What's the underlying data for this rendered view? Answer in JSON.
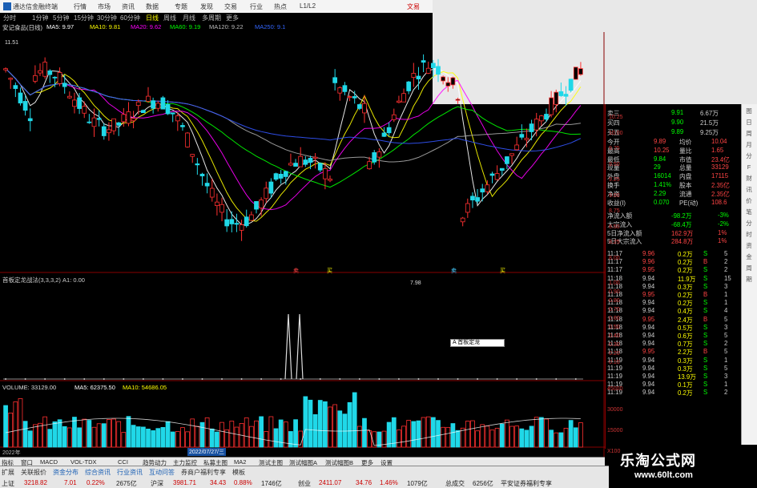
{
  "window": {
    "title": "通达信金融终端",
    "right_label": "文易"
  },
  "menu": [
    "行情",
    "市场",
    "资讯",
    "数据",
    "专题",
    "发现",
    "交易",
    "行业",
    "热点",
    "L1/L2"
  ],
  "periods": [
    "分时",
    "1分钟",
    "5分钟",
    "15分钟",
    "30分钟",
    "60分钟",
    "日线",
    "周线",
    "月线",
    "多周期",
    "更多"
  ],
  "active_period": "日线",
  "chart_info": {
    "name": "安记食品(日线)",
    "ma": [
      "MA5: 9.97",
      "MA10: 9.81",
      "MA20: 9.62",
      "MA60: 9.19",
      "MA120: 9.22",
      "MA250: 9.1"
    ],
    "ma_colors": [
      "#ffffff",
      "#ffff00",
      "#ff00ff",
      "#00ff00",
      "#aaaaaa",
      "#3355ff"
    ],
    "high_label": "11.51",
    "low_label": "7.98"
  },
  "indicator": {
    "label": "首板定龙战法(3,3,3,2) A1: 0.00",
    "tooltip": "A 首板定龙"
  },
  "volume": {
    "label": "VOLUME: 33129.00",
    "ma5": "MA5: 62375.50",
    "ma10": "MA10: 54686.05",
    "date_label": "2022/07/27/三",
    "year_label": "2022年"
  },
  "price_ticks": [
    "10.25",
    "10.00",
    "9.75",
    "9.50",
    "9.25",
    "9.00",
    "8.75",
    "8.50",
    "8.25",
    "8.00"
  ],
  "ind_ticks": [
    "1.00",
    "0.90",
    "0.80",
    "0.70",
    "0.60",
    "0.50",
    "0.40",
    "0.30",
    "0.20",
    "0.10"
  ],
  "vol_ticks": [
    "45000",
    "30000",
    "15000",
    "X100"
  ],
  "markers": {
    "sell_a": "卖",
    "buy_a": "买",
    "sell_b": "卖",
    "buy_b": "买"
  },
  "quote": {
    "ask3": [
      "卖三",
      "9.91",
      "6.67万"
    ],
    "ask4": [
      "买四",
      "9.90",
      "21.5万"
    ],
    "ask5": [
      "买五",
      "9.89",
      "9.25万"
    ],
    "rows": [
      [
        "今开",
        "9.89",
        "均价",
        "10.04"
      ],
      [
        "最高",
        "10.25",
        "量比",
        "1.65"
      ],
      [
        "最低",
        "9.84",
        "市值",
        "23.4亿"
      ],
      [
        "现量",
        "29",
        "总量",
        "33129"
      ],
      [
        "外盘",
        "16014",
        "内盘",
        "17115"
      ],
      [
        "换手",
        "1.41%",
        "股本",
        "2.35亿"
      ],
      [
        "净资",
        "2.29",
        "流通",
        "2.35亿"
      ],
      [
        "收益(I)",
        "0.070",
        "PE(动)",
        "108.6"
      ]
    ],
    "flows": [
      [
        "净流入额",
        "-98.2万",
        "-3%"
      ],
      [
        "大宗流入",
        "-68.4万",
        "-2%"
      ],
      [
        "5日净流入额",
        "162.9万",
        "1%"
      ],
      [
        "5日大宗流入",
        "284.8万",
        "1%"
      ]
    ]
  },
  "ticks": [
    [
      "11:17",
      "9.96",
      "0.2万",
      "S",
      "5"
    ],
    [
      "11:17",
      "9.96",
      "0.2万",
      "B",
      "2"
    ],
    [
      "11:17",
      "9.95",
      "0.2万",
      "S",
      "2"
    ],
    [
      "11:18",
      "9.94",
      "11.9万",
      "S",
      "15"
    ],
    [
      "11:18",
      "9.94",
      "0.3万",
      "S",
      "3"
    ],
    [
      "11:18",
      "9.95",
      "0.2万",
      "B",
      "1"
    ],
    [
      "11:18",
      "9.94",
      "0.2万",
      "S",
      "1"
    ],
    [
      "11:18",
      "9.94",
      "0.4万",
      "S",
      "4"
    ],
    [
      "11:18",
      "9.95",
      "2.4万",
      "B",
      "5"
    ],
    [
      "11:18",
      "9.94",
      "0.5万",
      "S",
      "3"
    ],
    [
      "11:18",
      "9.94",
      "0.6万",
      "S",
      "5"
    ],
    [
      "11:18",
      "9.94",
      "0.7万",
      "S",
      "2"
    ],
    [
      "11:18",
      "9.95",
      "2.2万",
      "B",
      "5"
    ],
    [
      "11:19",
      "9.94",
      "0.3万",
      "S",
      "1"
    ],
    [
      "11:19",
      "9.94",
      "0.3万",
      "S",
      "5"
    ],
    [
      "11:19",
      "9.94",
      "13.9万",
      "S",
      "3"
    ],
    [
      "11:19",
      "9.94",
      "0.1万",
      "S",
      "1"
    ],
    [
      "11:19",
      "9.94",
      "0.2万",
      "S",
      "2"
    ]
  ],
  "bottom_tabs": [
    "指标",
    "窗口",
    "MACD",
    "VOL-TDX",
    "CCI",
    "趋势动力",
    "主力监控",
    "私募主图",
    "MA2",
    "测试主图",
    "测试幅图A",
    "测试幅图B",
    "更多",
    "设置"
  ],
  "bottom_tabs_right": [
    "扩展",
    "关联报价",
    "资金分布",
    "综合资讯",
    "行业资讯",
    "互动问答",
    "券商户福利专享",
    "模板"
  ],
  "side_tabs": [
    "图",
    "日",
    "周",
    "月",
    "分",
    "F",
    "财",
    "讯",
    "价",
    "笔",
    "分",
    "时",
    "资",
    "金",
    "周",
    "期"
  ],
  "status": {
    "sh": [
      "上证",
      "3218.82",
      "7.01",
      "0.22%",
      "2675亿"
    ],
    "sz": [
      "沪深",
      "3981.71",
      "34.43",
      "0.88%",
      "1746亿"
    ],
    "cy": [
      "创业",
      "2411.07",
      "34.76",
      "1.46%",
      "1079亿"
    ],
    "total": [
      "总成交",
      "6256亿"
    ],
    "broker": "平安证券福利专享"
  },
  "watermark": {
    "title": "乐淘公式网",
    "url": "www.60lt.com"
  }
}
